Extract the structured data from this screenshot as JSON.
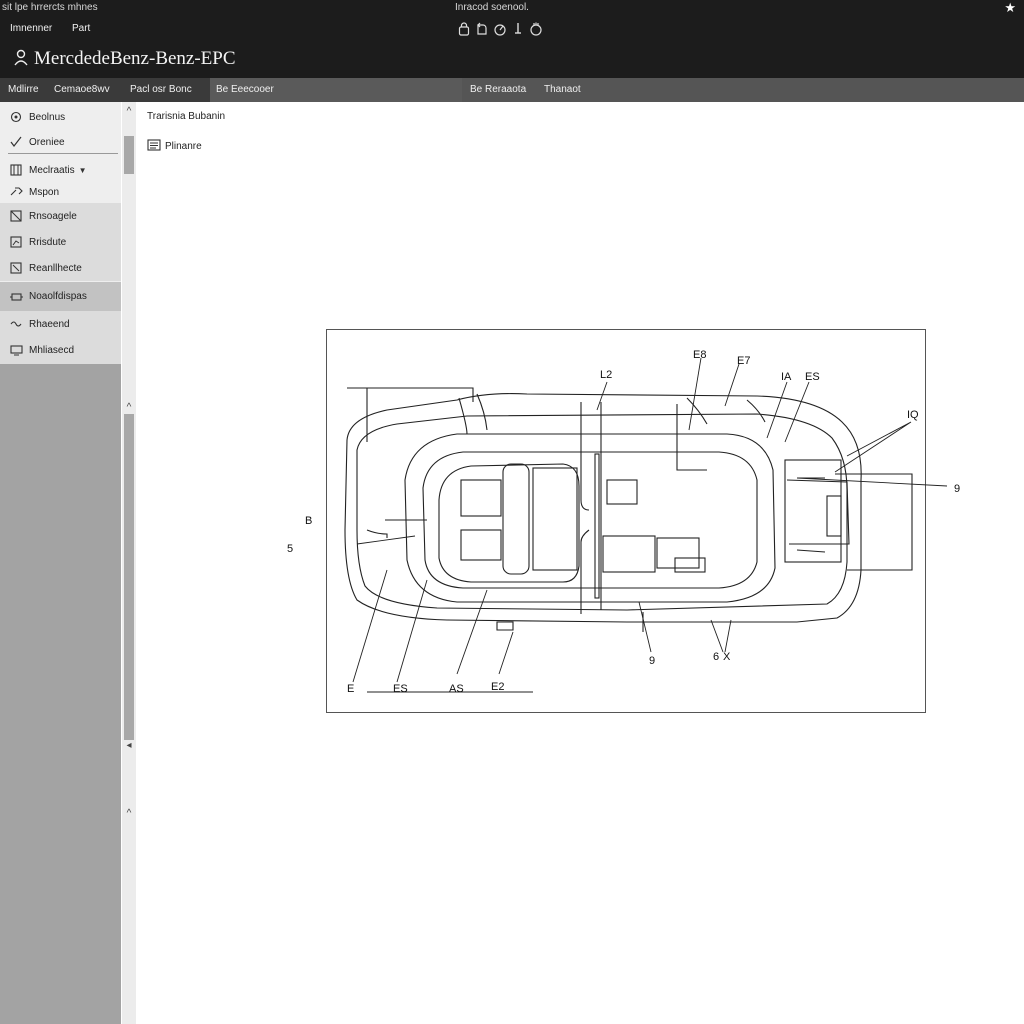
{
  "window": {
    "caption_left": "sit lpe hrrercts mhnes",
    "caption_center": "Inracod soenool.",
    "menu": [
      "Imnenner",
      "Part"
    ],
    "icons": [
      "lock-icon",
      "rotate-icon",
      "gauge-icon",
      "key-icon",
      "hand-icon"
    ],
    "close_icon": "star-icon"
  },
  "app": {
    "title": "MercdedeBenz-Benz-EPC"
  },
  "tabs": [
    {
      "label": "Mdlirre"
    },
    {
      "label": "Cemaoe8wv"
    },
    {
      "label": "Pacl osr Bonc"
    },
    {
      "label": "Be Eeecooer"
    },
    {
      "label": "Be Reraaota"
    },
    {
      "label": "Thanaot"
    }
  ],
  "sidebar": {
    "items": [
      {
        "label": "Beolnus",
        "icon": "gear-icon"
      },
      {
        "label": "Oreniee",
        "icon": "check-icon"
      },
      {
        "label": "Meclraatis",
        "icon": "panel-icon"
      },
      {
        "label": "Mspon",
        "icon": "wrench-icon"
      },
      {
        "label": "Rnsoagele",
        "icon": "box-icon"
      },
      {
        "label": "Rrisdute",
        "icon": "chart-icon"
      },
      {
        "label": "Reanllhecte",
        "icon": "frame-icon"
      },
      {
        "label": "Noaolfdispas",
        "icon": "engine-icon"
      },
      {
        "label": "Rhaeend",
        "icon": "signal-icon"
      },
      {
        "label": "Mhliasecd",
        "icon": "monitor-icon"
      }
    ]
  },
  "content": {
    "breadcrumb": "Trarisnia Bubanin",
    "sub_label": "Plinanre"
  },
  "diagram": {
    "callouts": [
      "E8",
      "E7",
      "L2",
      "IA",
      "ES",
      "IQ",
      "9",
      "B",
      "5",
      "E",
      "ES",
      "AS",
      "E2",
      "9",
      "6",
      "X"
    ]
  }
}
